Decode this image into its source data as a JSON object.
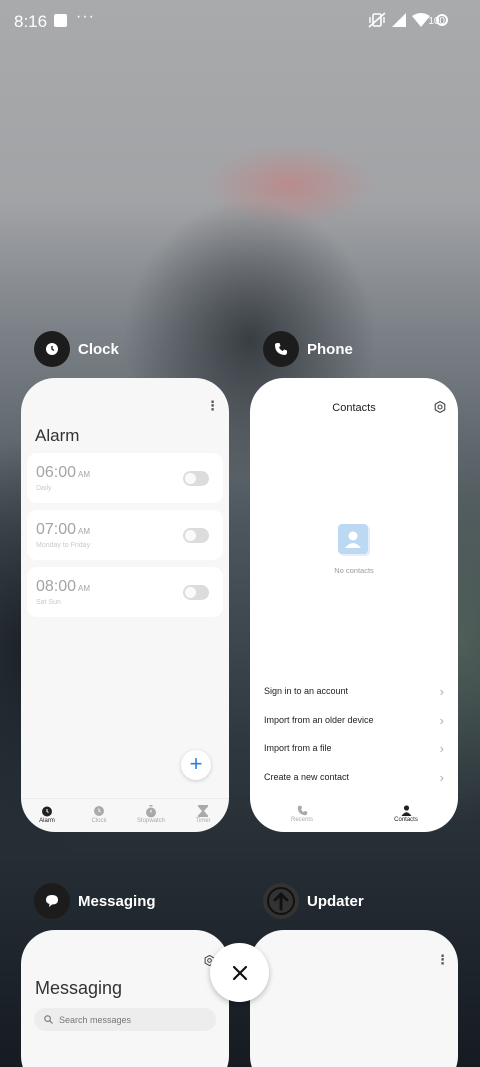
{
  "status_bar": {
    "time": "8:16",
    "overflow": "···",
    "battery": "100",
    "icons": [
      "screenshot-notification-icon",
      "vibrate-off-icon",
      "signal-icon",
      "wifi-icon",
      "battery-icon"
    ]
  },
  "apps": {
    "clock": {
      "name": "Clock",
      "alarm_title": "Alarm",
      "alarms": [
        {
          "time": "06:00",
          "ampm": "AM",
          "repeat": "Daily"
        },
        {
          "time": "07:00",
          "ampm": "AM",
          "repeat": "Monday to Friday"
        },
        {
          "time": "08:00",
          "ampm": "AM",
          "repeat": "Sat Sun"
        }
      ],
      "fab": "+",
      "nav": [
        {
          "label": "Alarm"
        },
        {
          "label": "Clock"
        },
        {
          "label": "Stopwatch"
        },
        {
          "label": "Timer"
        }
      ]
    },
    "phone": {
      "name": "Phone",
      "title": "Contacts",
      "empty_text": "No contacts",
      "actions": [
        {
          "label": "Sign in to an account"
        },
        {
          "label": "Import from an older device"
        },
        {
          "label": "Import from a file"
        },
        {
          "label": "Create a new contact"
        }
      ],
      "nav": [
        {
          "label": "Recents"
        },
        {
          "label": "Contacts"
        }
      ]
    },
    "messaging": {
      "name": "Messaging",
      "title": "Messaging",
      "search_placeholder": "Search messages"
    },
    "updater": {
      "name": "Updater"
    }
  },
  "close_button": "×",
  "colors": {
    "accent": "#2a7de1",
    "card_bg": "#f7f7f7"
  }
}
